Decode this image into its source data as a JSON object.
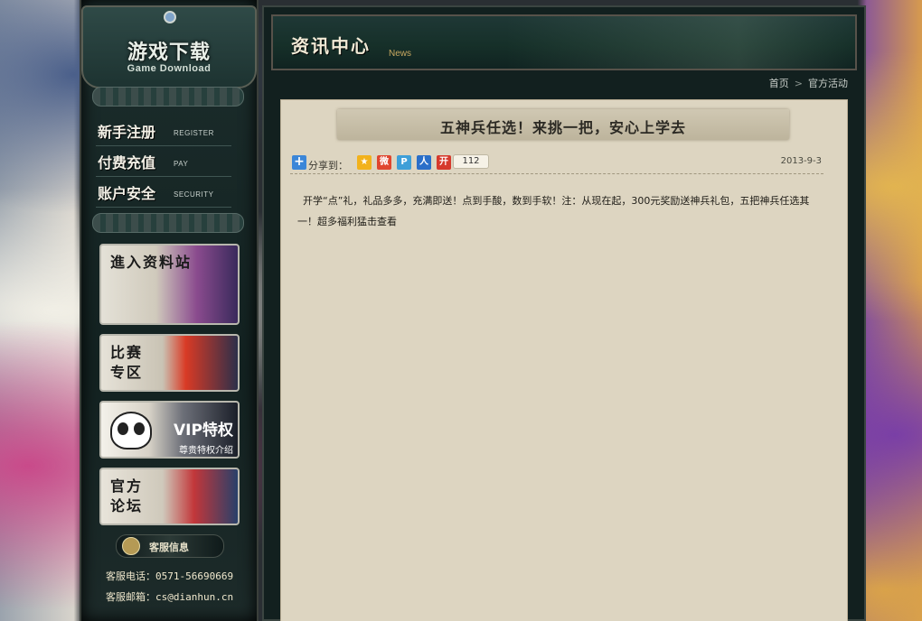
{
  "sidebar": {
    "title": "游戏下载",
    "subtitle": "Game Download",
    "menu": [
      {
        "cn": "新手注册",
        "en": "REGISTER"
      },
      {
        "cn": "付费充值",
        "en": "PAY"
      },
      {
        "cn": "账户安全",
        "en": "SECURITY"
      }
    ],
    "promos": [
      {
        "text": "進入资料站"
      },
      {
        "text": "比赛\n专区"
      },
      {
        "text": "VIP特权",
        "sub": "尊贵特权介绍"
      },
      {
        "text": "官方\n论坛"
      }
    ],
    "service": {
      "label": "客服信息",
      "phone": "客服电话：0571-56690669",
      "email": "客服邮箱：cs@dianhun.cn"
    }
  },
  "banner": {
    "title": "资讯中心",
    "subtitle": "News"
  },
  "breadcrumb": {
    "home": "首页",
    "separator": ">",
    "current": "官方活动"
  },
  "article": {
    "title": "五神兵任选！来挑一把，安心上学去",
    "share_label": "分享到：",
    "share_count": "112",
    "date": "2013-9-3",
    "body": "开学“点”礼，礼品多多，充满即送！点到手酸，数到手软！注：从现在起，300元奖励送神兵礼包，五把神兵任选其一！超多福利猛击查看"
  },
  "share_icons": [
    {
      "name": "qzone-icon",
      "color": "#f2b21c",
      "glyph": "★"
    },
    {
      "name": "weibo-icon",
      "color": "#e0462f",
      "glyph": "微"
    },
    {
      "name": "tencent-weibo-icon",
      "color": "#3e9fd8",
      "glyph": "P"
    },
    {
      "name": "renren-icon",
      "color": "#2a6fc9",
      "glyph": "人"
    },
    {
      "name": "kaixin-icon",
      "color": "#d6392c",
      "glyph": "开"
    }
  ]
}
